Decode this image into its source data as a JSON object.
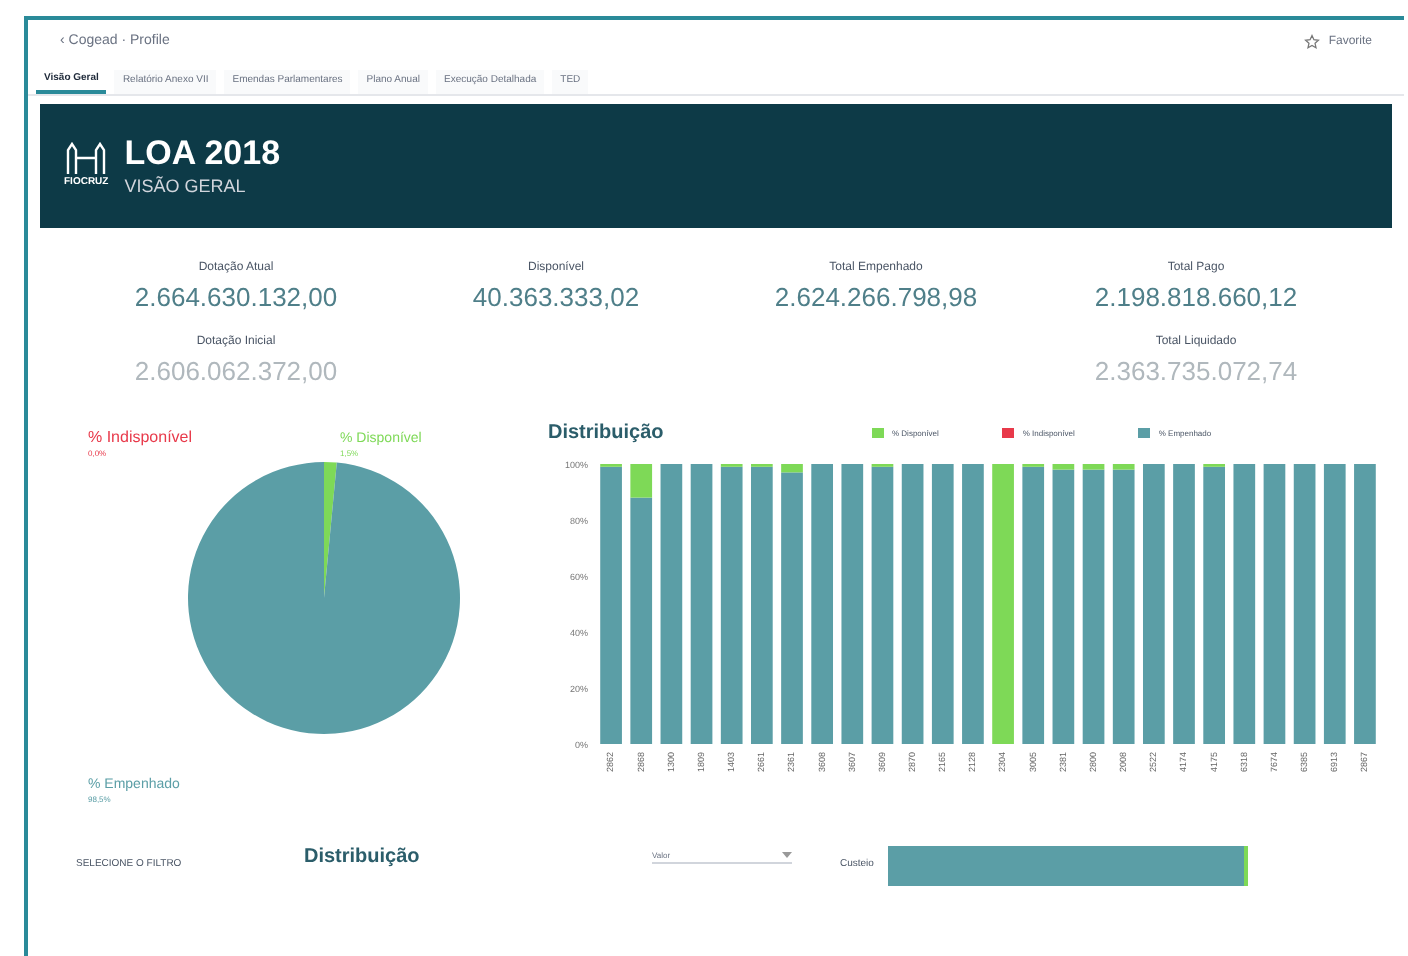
{
  "nav": {
    "back": "‹ Cogead · Profile",
    "favorite": "Favorite"
  },
  "tabs": [
    {
      "label": "Visão Geral",
      "selected": true
    },
    {
      "label": "Relatório Anexo VII",
      "selected": false
    },
    {
      "label": "Emendas Parlamentares",
      "selected": false
    },
    {
      "label": "Plano Anual",
      "selected": false
    },
    {
      "label": "Execução Detalhada",
      "selected": false
    },
    {
      "label": "TED",
      "selected": false
    }
  ],
  "header": {
    "logo": "FIOCRUZ",
    "title": "LOA 2018",
    "subtitle": "VISÃO GERAL"
  },
  "kpis": [
    {
      "label": "Dotação Atual",
      "value": "2.664.630.132,00",
      "muted": false
    },
    {
      "label": "Disponível",
      "value": "40.363.333,02",
      "muted": false
    },
    {
      "label": "Total Empenhado",
      "value": "2.624.266.798,98",
      "muted": false
    },
    {
      "label": "Total Pago",
      "value": "2.198.818.660,12",
      "muted": false
    },
    {
      "label": "Dotação Inicial",
      "value": "2.606.062.372,00",
      "muted": true
    },
    {
      "label": "Total Liquidado",
      "value": "2.363.735.072,74",
      "muted": true
    }
  ],
  "pie": {
    "chart_data": {
      "type": "pie",
      "categories": [
        "% Indisponível",
        "% Disponível",
        "% Empenhado"
      ],
      "values": [
        0.0,
        1.5,
        98.5
      ],
      "value_labels": [
        "0,0%",
        "1,5%",
        "98,5%"
      ]
    },
    "slices": [
      {
        "color": "#e8394a"
      },
      {
        "color": "#7ed957"
      },
      {
        "color": "#5b9ea6"
      }
    ]
  },
  "bars": {
    "title": "Distribuição",
    "chart_data": {
      "type": "bar",
      "stacked": true,
      "categories": [
        "2862",
        "2868",
        "1300",
        "1809",
        "1403",
        "2661",
        "2361",
        "3608",
        "3607",
        "3609",
        "2870",
        "2165",
        "2128",
        "2304",
        "3005",
        "2381",
        "2800",
        "2008",
        "2522",
        "4174",
        "4175",
        "6318",
        "7674",
        "6385",
        "6913",
        "2867"
      ],
      "yticks": [
        {
          "value": 0,
          "label": "0%"
        },
        {
          "value": 20,
          "label": "20%"
        },
        {
          "value": 40,
          "label": "40%"
        },
        {
          "value": 60,
          "label": "60%"
        },
        {
          "value": 80,
          "label": "80%"
        },
        {
          "value": 100,
          "label": "100%"
        }
      ],
      "ylim": [
        0,
        100
      ],
      "series": [
        {
          "name": "% Empenhado",
          "color": "#5b9ea6",
          "values": [
            99,
            88,
            100,
            100,
            99,
            99,
            97,
            100,
            100,
            99,
            100,
            100,
            100,
            0,
            99,
            98,
            98,
            98,
            100,
            100,
            99,
            100,
            100,
            100,
            100,
            100
          ]
        },
        {
          "name": "% Indisponível",
          "color": "#e8394a",
          "values": [
            0,
            0,
            0,
            0,
            0,
            0,
            0,
            0,
            0,
            0,
            0,
            0,
            0,
            0,
            0,
            0,
            0,
            0,
            0,
            0,
            0,
            0,
            0,
            0,
            0,
            0
          ]
        },
        {
          "name": "% Disponível",
          "color": "#7ed957",
          "values": [
            1,
            12,
            0,
            0,
            1,
            1,
            3,
            0,
            0,
            1,
            0,
            0,
            0,
            100,
            1,
            2,
            2,
            2,
            0,
            0,
            1,
            0,
            0,
            0,
            0,
            0
          ]
        }
      ]
    }
  },
  "bottom": {
    "filter_label": "SELECIONE O FILTRO",
    "title": "Distribuição",
    "select_label": "Valor",
    "bar_label": "Custeio",
    "bar": {
      "level": 0.99
    }
  }
}
